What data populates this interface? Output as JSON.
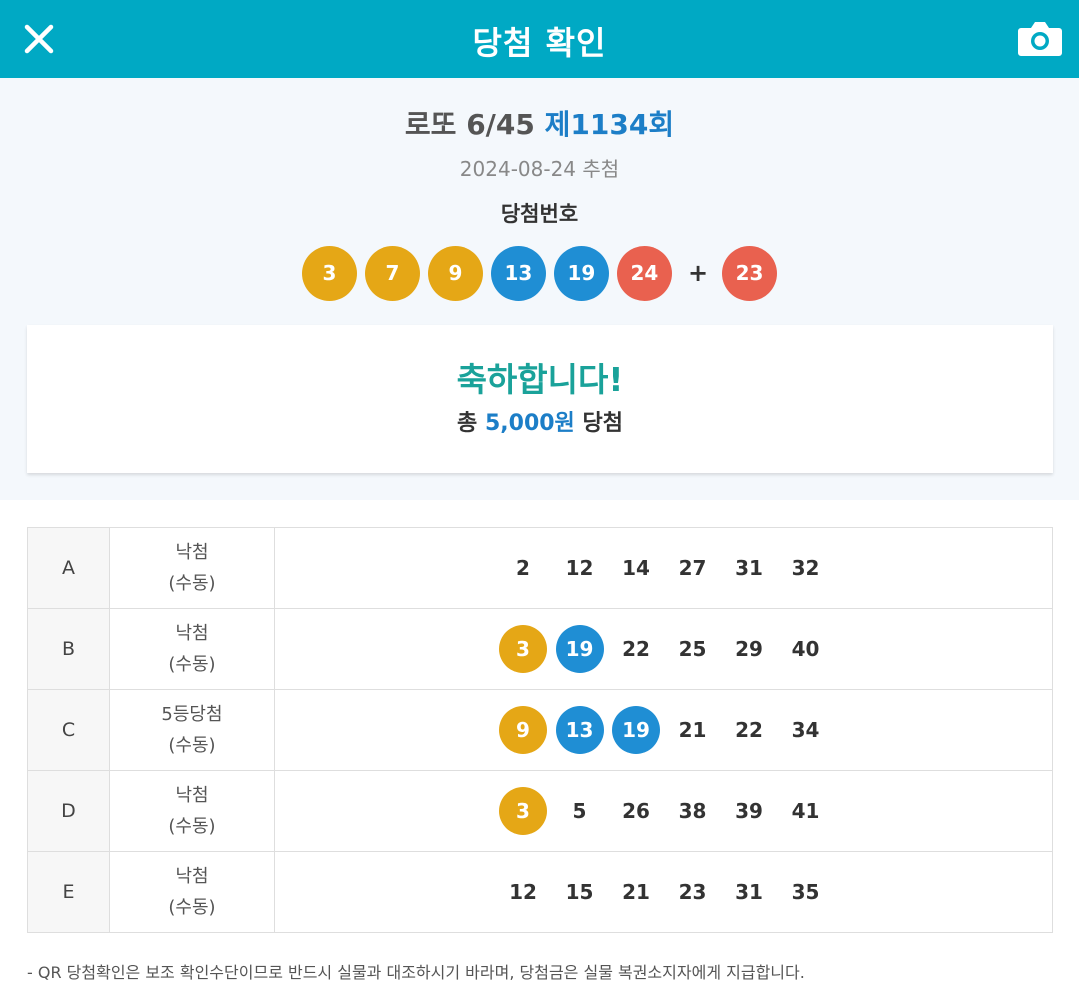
{
  "header": {
    "title": "당첨 확인"
  },
  "draw": {
    "name": "로또 6/45",
    "round": "제1134회",
    "date": "2024-08-24 추첨",
    "winning_label": "당첨번호",
    "numbers": [
      {
        "value": "3",
        "color": "#e5a716"
      },
      {
        "value": "7",
        "color": "#e5a716"
      },
      {
        "value": "9",
        "color": "#e5a716"
      },
      {
        "value": "13",
        "color": "#1f8ed4"
      },
      {
        "value": "19",
        "color": "#1f8ed4"
      },
      {
        "value": "24",
        "color": "#e9614f"
      }
    ],
    "plus": "+",
    "bonus": {
      "value": "23",
      "color": "#e9614f"
    }
  },
  "result": {
    "congrats": "축하합니다!",
    "prefix": "총",
    "amount": "5,000원",
    "suffix": "당첨"
  },
  "games": [
    {
      "id": "A",
      "result": "낙첨",
      "mode": "(수동)",
      "numbers": [
        {
          "value": "2",
          "match": false
        },
        {
          "value": "12",
          "match": false
        },
        {
          "value": "14",
          "match": false
        },
        {
          "value": "27",
          "match": false
        },
        {
          "value": "31",
          "match": false
        },
        {
          "value": "32",
          "match": false
        }
      ]
    },
    {
      "id": "B",
      "result": "낙첨",
      "mode": "(수동)",
      "numbers": [
        {
          "value": "3",
          "match": true,
          "color": "#e5a716"
        },
        {
          "value": "19",
          "match": true,
          "color": "#1f8ed4"
        },
        {
          "value": "22",
          "match": false
        },
        {
          "value": "25",
          "match": false
        },
        {
          "value": "29",
          "match": false
        },
        {
          "value": "40",
          "match": false
        }
      ]
    },
    {
      "id": "C",
      "result": "5등당첨",
      "mode": "(수동)",
      "numbers": [
        {
          "value": "9",
          "match": true,
          "color": "#e5a716"
        },
        {
          "value": "13",
          "match": true,
          "color": "#1f8ed4"
        },
        {
          "value": "19",
          "match": true,
          "color": "#1f8ed4"
        },
        {
          "value": "21",
          "match": false
        },
        {
          "value": "22",
          "match": false
        },
        {
          "value": "34",
          "match": false
        }
      ]
    },
    {
      "id": "D",
      "result": "낙첨",
      "mode": "(수동)",
      "numbers": [
        {
          "value": "3",
          "match": true,
          "color": "#e5a716"
        },
        {
          "value": "5",
          "match": false
        },
        {
          "value": "26",
          "match": false
        },
        {
          "value": "38",
          "match": false
        },
        {
          "value": "39",
          "match": false
        },
        {
          "value": "41",
          "match": false
        }
      ]
    },
    {
      "id": "E",
      "result": "낙첨",
      "mode": "(수동)",
      "numbers": [
        {
          "value": "12",
          "match": false
        },
        {
          "value": "15",
          "match": false
        },
        {
          "value": "21",
          "match": false
        },
        {
          "value": "23",
          "match": false
        },
        {
          "value": "31",
          "match": false
        },
        {
          "value": "35",
          "match": false
        }
      ]
    }
  ],
  "footnote": "- QR 당첨확인은 보조 확인수단이므로 반드시 실물과 대조하시기 바라며, 당첨금은 실물 복권소지자에게 지급합니다.",
  "icons": {
    "close": "close-icon",
    "camera": "camera-icon"
  }
}
